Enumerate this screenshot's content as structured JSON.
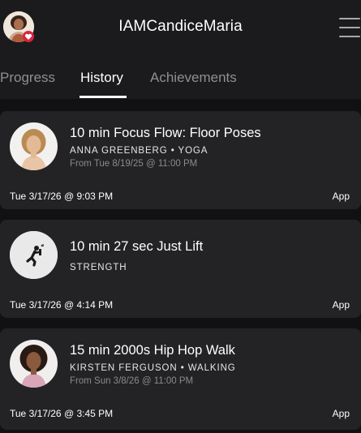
{
  "header": {
    "username": "IAMCandiceMaria"
  },
  "tabs": [
    {
      "label": "Progress",
      "active": false
    },
    {
      "label": "History",
      "active": true
    },
    {
      "label": "Achievements",
      "active": false
    }
  ],
  "workouts": [
    {
      "title": "10 min Focus Flow: Floor Poses",
      "meta": "ANNA GREENBERG • YOGA",
      "from": "From Tue 8/19/25 @ 11:00 PM",
      "date": "Tue 3/17/26 @ 9:03 PM",
      "platform": "App",
      "thumb": "instructor-photo"
    },
    {
      "title": "10 min 27 sec Just Lift",
      "meta": "STRENGTH",
      "from": "",
      "date": "Tue 3/17/26 @ 4:14 PM",
      "platform": "App",
      "thumb": "lifting-icon"
    },
    {
      "title": "15 min 2000s Hip Hop Walk",
      "meta": "KIRSTEN FERGUSON • WALKING",
      "from": "From Sun 3/8/26 @ 11:00 PM",
      "date": "Tue 3/17/26 @ 3:45 PM",
      "platform": "App",
      "thumb": "instructor-photo"
    }
  ],
  "colors": {
    "background": "#111113",
    "card": "#232326",
    "header": "#1b1b1e",
    "muted_text": "#8f8f94",
    "badge_red": "#d7263d"
  }
}
